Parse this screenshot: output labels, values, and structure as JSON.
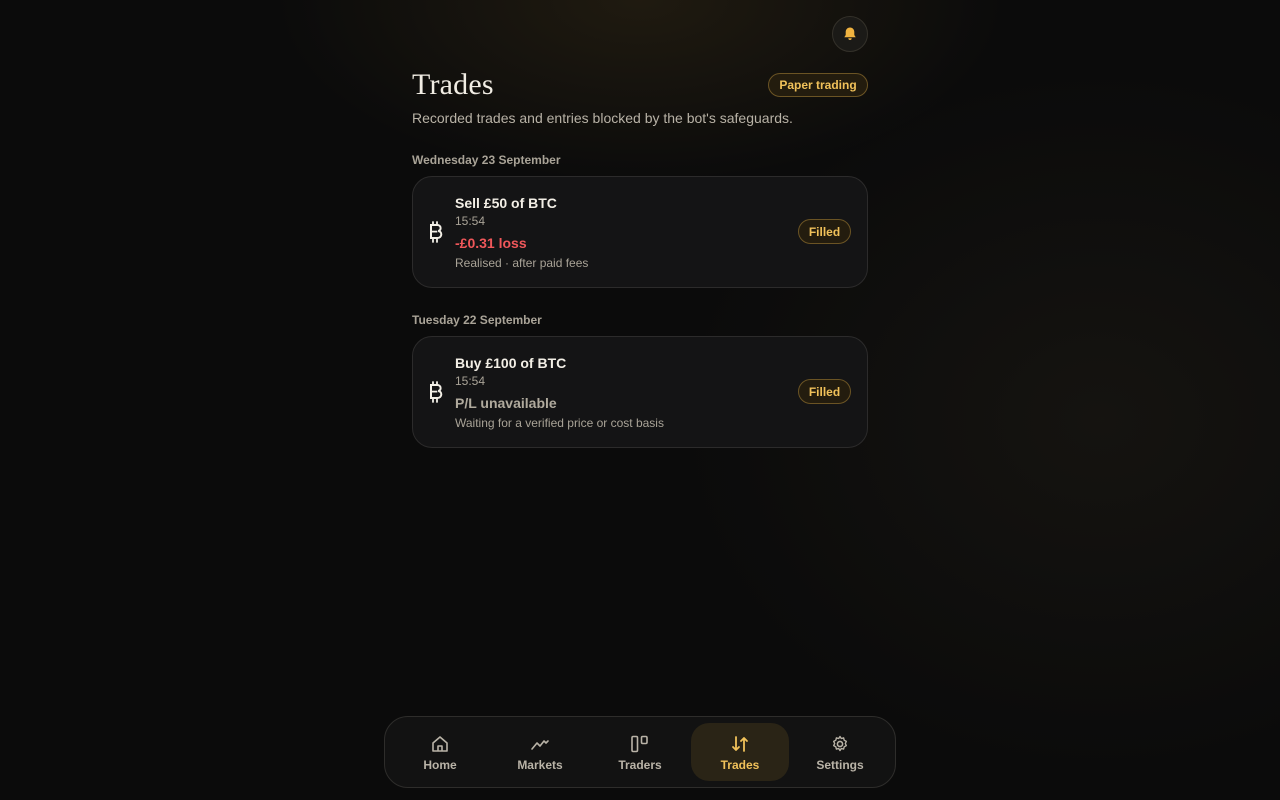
{
  "header": {
    "title": "Trades",
    "mode_badge": "Paper trading",
    "subtitle": "Recorded trades and entries blocked by the bot's safeguards."
  },
  "days": [
    {
      "label": "Wednesday 23 September",
      "trades": [
        {
          "coin_icon": "bitcoin-icon",
          "title": "Sell £50 of BTC",
          "time": "15:54",
          "pl": "-£0.31 loss",
          "pl_note": "Realised · after paid fees",
          "status": "Filled"
        }
      ]
    },
    {
      "label": "Tuesday 22 September",
      "trades": [
        {
          "coin_icon": "bitcoin-icon",
          "title": "Buy £100 of BTC",
          "time": "15:54",
          "pl": "P/L unavailable",
          "pl_note": "Waiting for a verified price or cost basis",
          "status": "Filled"
        }
      ]
    }
  ],
  "nav": {
    "items": [
      {
        "label": "Home",
        "icon": "home-icon"
      },
      {
        "label": "Markets",
        "icon": "chart-line-icon"
      },
      {
        "label": "Traders",
        "icon": "columns-icon"
      },
      {
        "label": "Trades",
        "icon": "arrows-up-down-icon",
        "active": true
      },
      {
        "label": "Settings",
        "icon": "gear-icon"
      }
    ]
  },
  "colors": {
    "accent": "#f0c15a",
    "loss": "#f0575a",
    "background": "#0b0b0b",
    "card": "#141415"
  }
}
